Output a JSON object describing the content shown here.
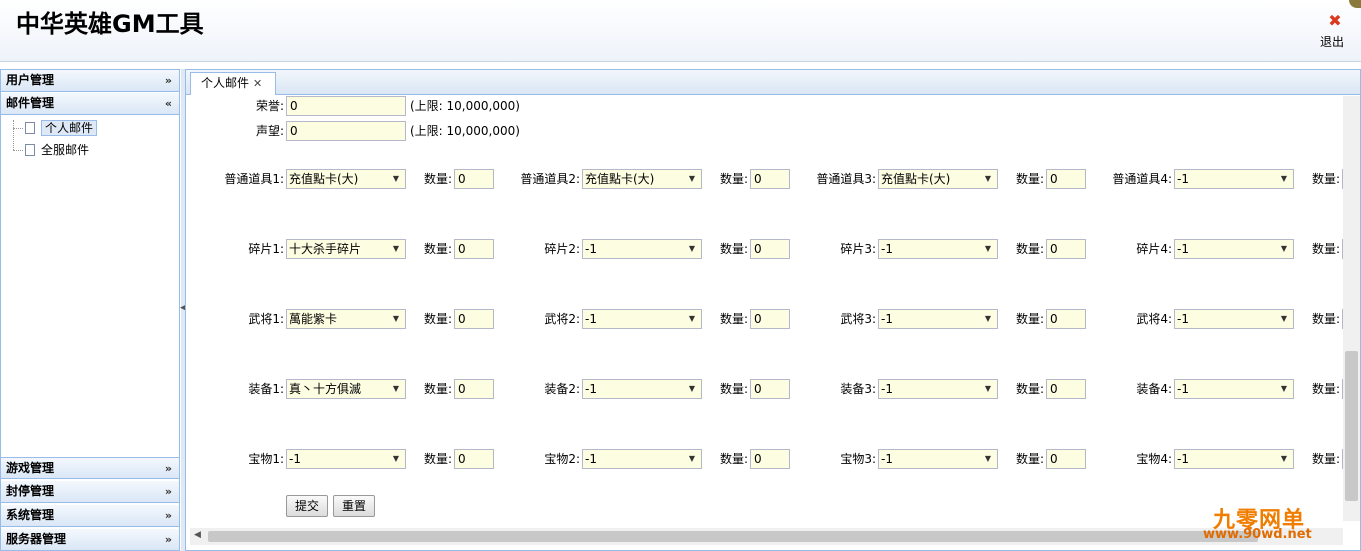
{
  "app": {
    "title": "中华英雄GM工具",
    "logout_label": "退出"
  },
  "sidebar": {
    "sections": [
      {
        "label": "用户管理"
      },
      {
        "label": "邮件管理"
      },
      {
        "label": "游戏管理"
      },
      {
        "label": "封停管理"
      },
      {
        "label": "系统管理"
      },
      {
        "label": "服务器管理"
      }
    ],
    "mail_items": [
      {
        "label": "个人邮件"
      },
      {
        "label": "全服邮件"
      }
    ]
  },
  "tabs": [
    {
      "label": "个人邮件"
    }
  ],
  "form": {
    "honor": {
      "label": "荣誉:",
      "value": "0",
      "hint": "(上限: 10,000,000)"
    },
    "prestige": {
      "label": "声望:",
      "value": "0",
      "hint": "(上限: 10,000,000)"
    },
    "qty_label": "数量:",
    "rows": [
      {
        "items": [
          {
            "label": "普通道具1:",
            "value": "充值點卡(大)",
            "qty": "0"
          },
          {
            "label": "普通道具2:",
            "value": "充值點卡(大)",
            "qty": "0"
          },
          {
            "label": "普通道具3:",
            "value": "充值點卡(大)",
            "qty": "0"
          },
          {
            "label": "普通道具4:",
            "value": "-1",
            "qty": ""
          }
        ]
      },
      {
        "items": [
          {
            "label": "碎片1:",
            "value": "十大杀手碎片",
            "qty": "0"
          },
          {
            "label": "碎片2:",
            "value": "-1",
            "qty": "0"
          },
          {
            "label": "碎片3:",
            "value": "-1",
            "qty": "0"
          },
          {
            "label": "碎片4:",
            "value": "-1",
            "qty": ""
          }
        ]
      },
      {
        "items": [
          {
            "label": "武将1:",
            "value": "萬能紫卡",
            "qty": "0"
          },
          {
            "label": "武将2:",
            "value": "-1",
            "qty": "0"
          },
          {
            "label": "武将3:",
            "value": "-1",
            "qty": "0"
          },
          {
            "label": "武将4:",
            "value": "-1",
            "qty": ""
          }
        ]
      },
      {
        "items": [
          {
            "label": "装备1:",
            "value": "真丶十方俱滅",
            "qty": "0"
          },
          {
            "label": "装备2:",
            "value": "-1",
            "qty": "0"
          },
          {
            "label": "装备3:",
            "value": "-1",
            "qty": "0"
          },
          {
            "label": "装备4:",
            "value": "-1",
            "qty": ""
          }
        ]
      },
      {
        "items": [
          {
            "label": "宝物1:",
            "value": "-1",
            "qty": "0"
          },
          {
            "label": "宝物2:",
            "value": "-1",
            "qty": "0"
          },
          {
            "label": "宝物3:",
            "value": "-1",
            "qty": "0"
          },
          {
            "label": "宝物4:",
            "value": "-1",
            "qty": ""
          }
        ]
      }
    ],
    "submit_label": "提交",
    "reset_label": "重置"
  },
  "watermark": {
    "title": "九零网单",
    "url": "www.90wd.net"
  }
}
